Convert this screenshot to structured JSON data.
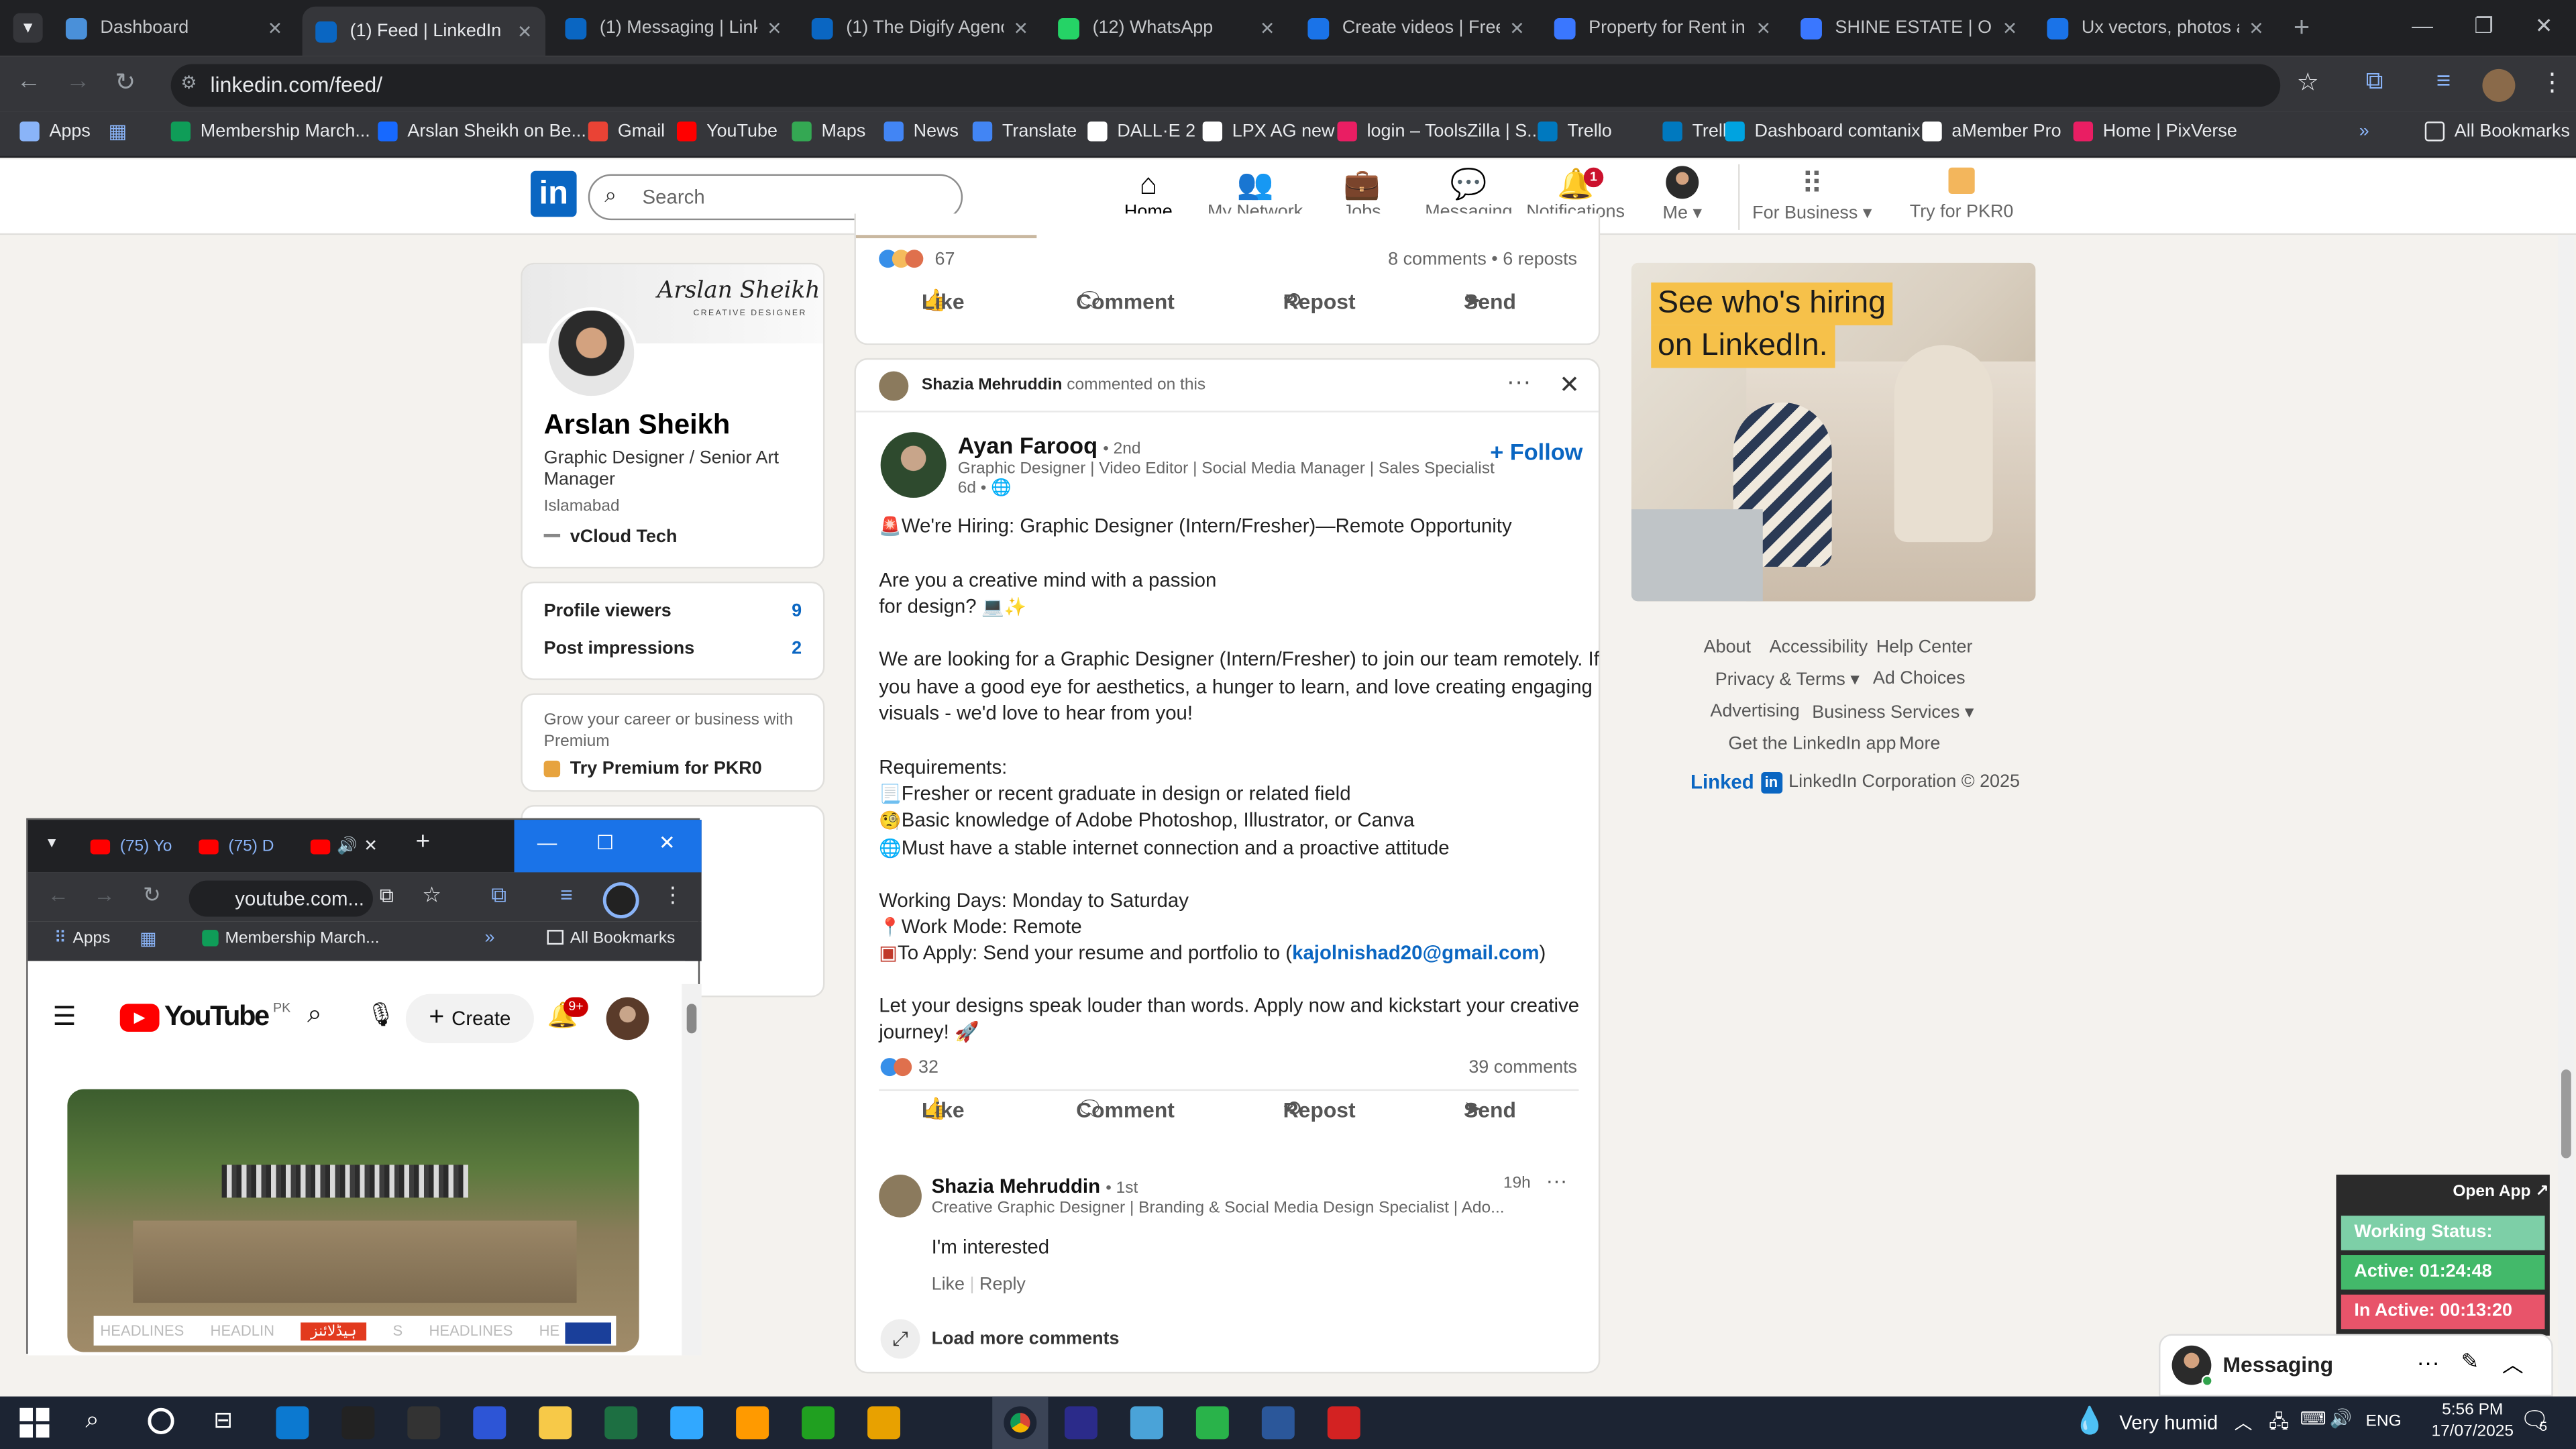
{
  "browser": {
    "tabs": [
      {
        "title": "Dashboard",
        "color": "#4a90d9"
      },
      {
        "title": "(1) Feed | LinkedIn",
        "color": "#0a66c2"
      },
      {
        "title": "(1) Messaging | Linke",
        "color": "#0a66c2"
      },
      {
        "title": "(1) The Digify Agency",
        "color": "#0a66c2"
      },
      {
        "title": "(12) WhatsApp",
        "color": "#25d366"
      },
      {
        "title": "Create videos | Freep",
        "color": "#1a73e8"
      },
      {
        "title": "Property for Rent in S",
        "color": "#3a77ff"
      },
      {
        "title": "SHINE ESTATE | OLX",
        "color": "#3a77ff"
      },
      {
        "title": "Ux vectors, photos an",
        "color": "#1a73e8"
      }
    ],
    "url": "linkedin.com/feed/",
    "bookmarks": [
      "Apps",
      "Membership March...",
      "Arslan Sheikh on Be...",
      "Gmail",
      "YouTube",
      "Maps",
      "News",
      "Translate",
      "DALL·E 2",
      "LPX AG new",
      "login – ToolsZilla | S...",
      "Trello",
      "Trello",
      "Dashboard comtanix",
      "aMember Pro",
      "Home | PixVerse"
    ],
    "all_bookmarks": "All Bookmarks"
  },
  "linkedin": {
    "logo": "in",
    "search_placeholder": "Search",
    "nav": [
      {
        "label": "Home"
      },
      {
        "label": "My Network"
      },
      {
        "label": "Jobs"
      },
      {
        "label": "Messaging"
      },
      {
        "label": "Notifications"
      },
      {
        "label": "Me"
      },
      {
        "label": "For Business"
      },
      {
        "label": "Try for PKR0"
      }
    ],
    "notif_badge": "1",
    "profile": {
      "name": "Arslan Sheikh",
      "banner_text": "Arslan Sheikh",
      "banner_sub": "CREATIVE DESIGNER",
      "headline": "Graphic Designer / Senior Art Manager",
      "location": "Islamabad",
      "company": "vCloud Tech",
      "stats": [
        {
          "label": "Profile viewers",
          "value": "9"
        },
        {
          "label": "Post impressions",
          "value": "2"
        }
      ],
      "premium_text": "Grow your career or business with Premium",
      "premium_cta": "Try Premium for PKR0"
    },
    "top_post": {
      "reactions": "67",
      "meta": "8 comments • 6 reposts",
      "actions": [
        "Like",
        "Comment",
        "Repost",
        "Send"
      ]
    },
    "post": {
      "context_name": "Shazia Mehruddin",
      "context_text": "commented on this",
      "author": "Ayan Farooq",
      "degree": "• 2nd",
      "subtitle": "Graphic Designer | Video Editor | Social Media Manager | Sales Specialist",
      "time": "6d •",
      "follow": "+ Follow",
      "lines": [
        "We're Hiring: Graphic Designer (Intern/Fresher)—Remote Opportunity",
        "",
        "Are you a creative mind with a passion",
        "for design?",
        "",
        "We are looking for a Graphic Designer (Intern/Fresher) to join our team remotely. If",
        "you have a good eye for aesthetics, a hunger to learn, and love creating engaging",
        "visuals - we'd love to hear from you!",
        "",
        "Requirements:",
        "Fresher or recent graduate in design or related field",
        "Basic knowledge of Adobe Photoshop, Illustrator, or Canva",
        "Must have a stable internet connection and a proactive attitude",
        "",
        "Working Days: Monday to Saturday",
        "Work Mode: Remote"
      ],
      "apply_prefix": "To Apply: Send your resume and portfolio to (",
      "apply_email": "kajolnishad20@gmail.com",
      "apply_suffix": ")",
      "closing_1": "Let your designs speak louder than words. Apply now and kickstart your creative",
      "closing_2": "journey!",
      "reactions": "32",
      "comments_count": "39 comments",
      "actions": [
        "Like",
        "Comment",
        "Repost",
        "Send"
      ],
      "comment": {
        "name": "Shazia Mehruddin",
        "degree": "• 1st",
        "headline": "Creative Graphic Designer | Branding & Social Media Design Specialist | Ado...",
        "time": "19h",
        "text": "I'm interested",
        "like": "Like",
        "reply": "Reply"
      },
      "load_more": "Load more comments"
    },
    "ad": {
      "line1": "See who's hiring",
      "line2": "on LinkedIn."
    },
    "footer": {
      "links_row1": [
        "About",
        "Accessibility",
        "Help Center"
      ],
      "links_row2": [
        "Privacy & Terms",
        "Ad Choices"
      ],
      "links_row3": [
        "Advertising",
        "Business Services"
      ],
      "links_row4": [
        "Get the LinkedIn app",
        "More"
      ],
      "brand": "Linked",
      "copyright": "LinkedIn Corporation © 2025"
    },
    "messaging": "Messaging"
  },
  "youtube_window": {
    "tabs": [
      "(75) Yo",
      "(75) D"
    ],
    "url": "youtube.com...",
    "bookmarks": [
      "Apps",
      "Membership March..."
    ],
    "all_bookmarks": "All Bookmarks",
    "logo": "YouTube",
    "country": "PK",
    "create": "Create",
    "notif": "9+",
    "ticker": [
      "HEADLINES",
      "HEADLIN",
      "ہیڈلائنز",
      "S",
      "HEADLINES",
      "HE"
    ]
  },
  "tracker": {
    "open_app": "Open App",
    "status": "Working Status: Active",
    "active": "Active: 01:24:48",
    "inactive": "In Active: 00:13:20"
  },
  "taskbar": {
    "weather": "Very humid",
    "lang": "ENG",
    "time": "5:56 PM",
    "date": "17/07/2025",
    "notif_count": "5"
  }
}
